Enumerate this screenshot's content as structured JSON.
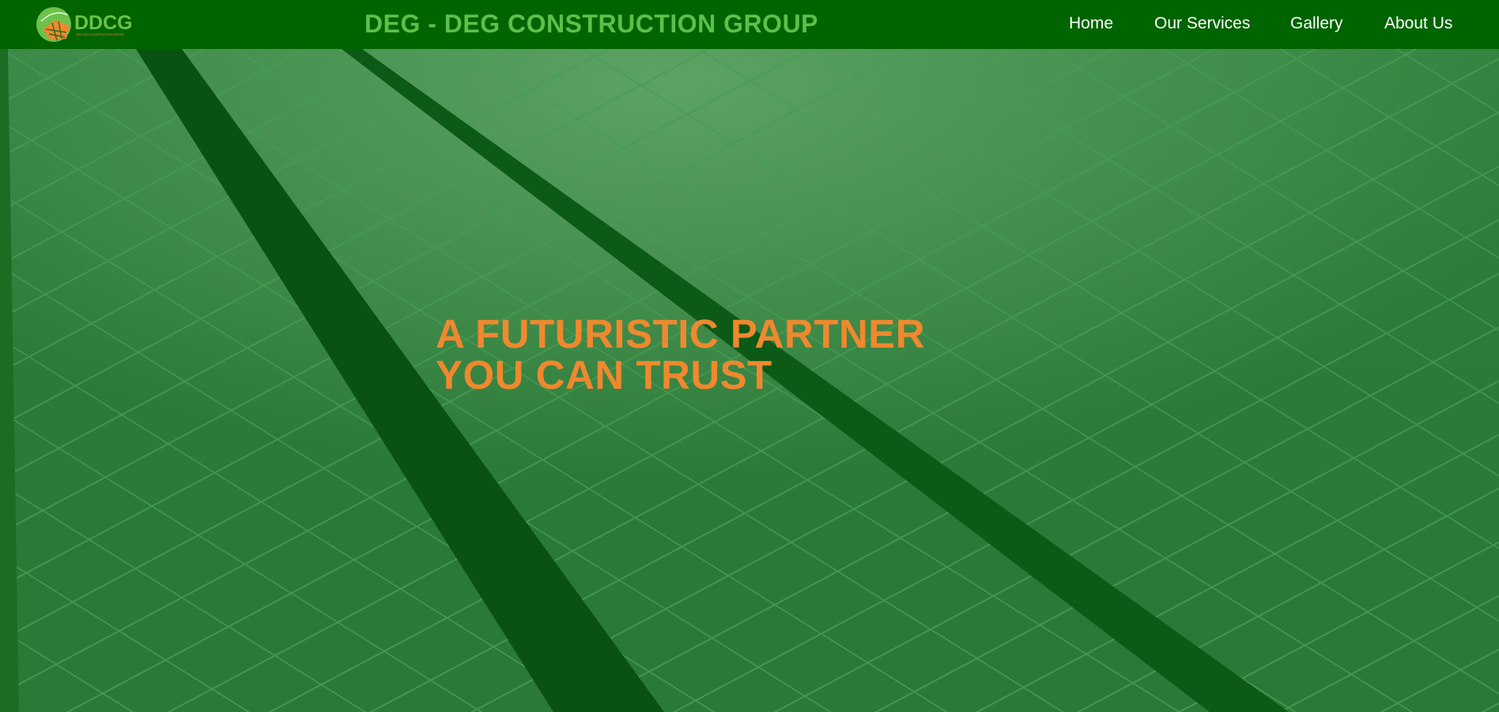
{
  "header": {
    "logo_text": "DDCG",
    "logo_tagline": "DEG-DEG CONSTRUCTION GROUP",
    "title": "DEG - DEG CONSTRUCTION GROUP"
  },
  "nav": {
    "items": [
      {
        "label": "Home"
      },
      {
        "label": "Our Services"
      },
      {
        "label": "Gallery"
      },
      {
        "label": "About Us"
      }
    ]
  },
  "hero": {
    "headline_line1": "A FUTURISTIC PARTNER",
    "headline_line2": "YOU CAN TRUST",
    "background": "solar-panels-image"
  },
  "colors": {
    "navbar": "#006400",
    "title": "#5cc04a",
    "nav_text": "#ffffff",
    "headline": "#f0882e",
    "hero_tint": "#2a7a3a"
  }
}
